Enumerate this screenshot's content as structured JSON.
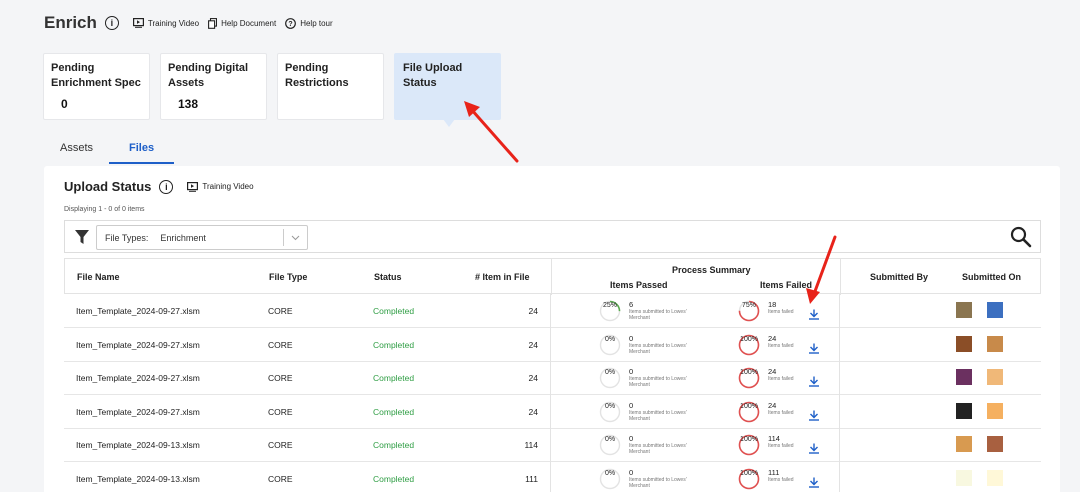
{
  "header": {
    "title": "Enrich",
    "links": [
      "Training Video",
      "Help Document",
      "Help tour"
    ]
  },
  "cards": [
    {
      "label": "Pending Enrichment Spec",
      "count": "0"
    },
    {
      "label": "Pending Digital Assets",
      "count": "138"
    },
    {
      "label": "Pending Restrictions",
      "count": ""
    },
    {
      "label": "File Upload Status",
      "count": ""
    }
  ],
  "tabs": [
    "Assets",
    "Files"
  ],
  "panel": {
    "title": "Upload Status",
    "training_video": "Training Video",
    "displaying": "Displaying 1 - 0 of 0 items",
    "filter_label": "File Types:",
    "filter_value": "Enrichment"
  },
  "table": {
    "headers": {
      "file_name": "File Name",
      "file_type": "File Type",
      "status": "Status",
      "items": "# Item in File",
      "process_summary": "Process Summary",
      "items_passed": "Items Passed",
      "items_failed": "Items Failed",
      "submitted_by": "Submitted By",
      "submitted_on": "Submitted On"
    },
    "passed_sub": "Items submitted to Lowes' Merchant",
    "failed_sub": "Items failed",
    "rows": [
      {
        "name": "Item_Template_2024-09-27.xlsm",
        "type": "CORE",
        "status": "Completed",
        "items": "24",
        "pass_pct": "25%",
        "pass_frac": 0.25,
        "passed": "6",
        "fail_pct": "75%",
        "fail_frac": 0.75,
        "failed": "18",
        "colors": [
          "#8a7550",
          "#3c6fc0"
        ]
      },
      {
        "name": "Item_Template_2024-09-27.xlsm",
        "type": "CORE",
        "status": "Completed",
        "items": "24",
        "pass_pct": "0%",
        "pass_frac": 0,
        "passed": "0",
        "fail_pct": "100%",
        "fail_frac": 1,
        "failed": "24",
        "colors": [
          "#8b4e27",
          "#c88a4a"
        ]
      },
      {
        "name": "Item_Template_2024-09-27.xlsm",
        "type": "CORE",
        "status": "Completed",
        "items": "24",
        "pass_pct": "0%",
        "pass_frac": 0,
        "passed": "0",
        "fail_pct": "100%",
        "fail_frac": 1,
        "failed": "24",
        "colors": [
          "#6b3060",
          "#f0b878"
        ]
      },
      {
        "name": "Item_Template_2024-09-27.xlsm",
        "type": "CORE",
        "status": "Completed",
        "items": "24",
        "pass_pct": "0%",
        "pass_frac": 0,
        "passed": "0",
        "fail_pct": "100%",
        "fail_frac": 1,
        "failed": "24",
        "colors": [
          "#222222",
          "#f5b060"
        ]
      },
      {
        "name": "Item_Template_2024-09-13.xlsm",
        "type": "CORE",
        "status": "Completed",
        "items": "114",
        "pass_pct": "0%",
        "pass_frac": 0,
        "passed": "0",
        "fail_pct": "100%",
        "fail_frac": 1,
        "failed": "114",
        "colors": [
          "#d89a50",
          "#a86040"
        ]
      },
      {
        "name": "Item_Template_2024-09-13.xlsm",
        "type": "CORE",
        "status": "Completed",
        "items": "111",
        "pass_pct": "0%",
        "pass_frac": 0,
        "passed": "0",
        "fail_pct": "100%",
        "fail_frac": 1,
        "failed": "111",
        "colors": [
          "#f8f8e0",
          "#fff8d8"
        ]
      }
    ]
  },
  "colors": {
    "accent": "#1e5fc8",
    "status_ok": "#2f9e44",
    "ring_red": "#e05050",
    "ring_green": "#5aaa50",
    "arrow": "#e8231a"
  }
}
